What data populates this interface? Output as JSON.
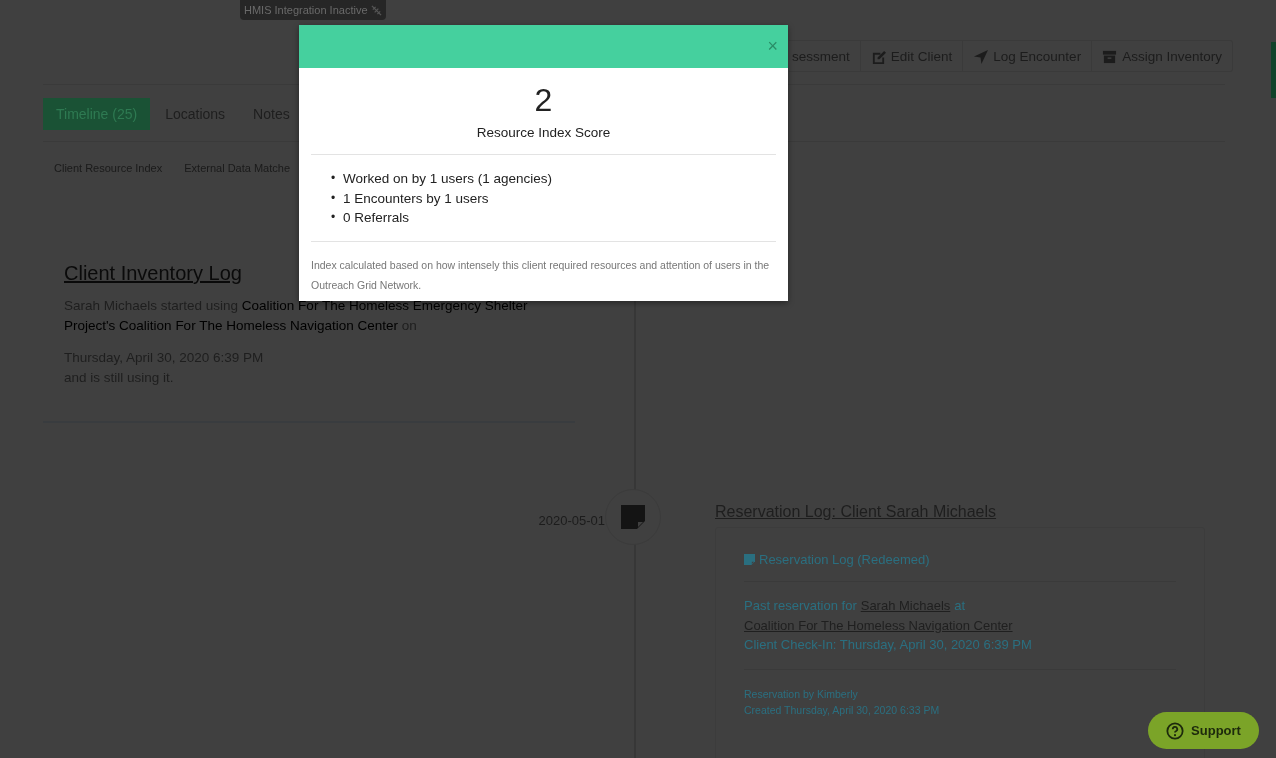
{
  "header": {
    "integration_badge": "HMIS Integration Inactive",
    "actions": [
      {
        "label": "sessment",
        "kind": "plain"
      },
      {
        "label": "Edit Client",
        "kind": "edit"
      },
      {
        "label": "Log Encounter",
        "kind": "send"
      },
      {
        "label": "Assign Inventory",
        "kind": "archive"
      }
    ]
  },
  "tabs": [
    {
      "label": "Timeline (25)",
      "selected": true
    },
    {
      "label": "Locations",
      "selected": false
    },
    {
      "label": "Notes",
      "selected": false
    }
  ],
  "subtabs": [
    {
      "label": "Client Resource Index"
    },
    {
      "label": "External Data Matche"
    }
  ],
  "timeline": [
    {
      "kind": "inventory",
      "title": "Client Inventory Log",
      "text": "Sarah Michaels started using **Coalition For The Homeless Emergency Shelter Project's Coalition For The Homeless Navigation Center** on",
      "date_time": "Thursday, April 30, 2020 6:39 PM",
      "status": "and is still using it."
    },
    {
      "kind": "reservation",
      "date": "2020-05-01",
      "title": "Reservation Log: Client Sarah Michaels",
      "heading": "Reservation Log (Redeemed)",
      "sentence": [
        {
          "text": "Past reservation for"
        },
        {
          "text": "Sarah Michaels",
          "link": true
        },
        {
          "text": "at"
        },
        {
          "text": "Coalition For The Homeless Navigation Center",
          "link": true
        }
      ],
      "check_in": "Client Check-In: Thursday, April 30, 2020 6:39 PM",
      "by": "Reservation by Kimberly",
      "created": "Created Thursday, April 30, 2020 6:33 PM"
    }
  ],
  "modal": {
    "close": "×",
    "score": "2",
    "score_label": "Resource Index Score",
    "facts": [
      {
        "bullet": "•",
        "text": "Worked on by 1 users (1 agencies)"
      },
      {
        "bullet": "•",
        "text": "1 Encounters by 1 users"
      },
      {
        "bullet": "•",
        "text": "0 Referrals"
      }
    ],
    "note": "Index calculated based on how intensely this client required resources and attention of users in the Outreach Grid Network."
  },
  "support_button": {
    "label": "Support"
  }
}
